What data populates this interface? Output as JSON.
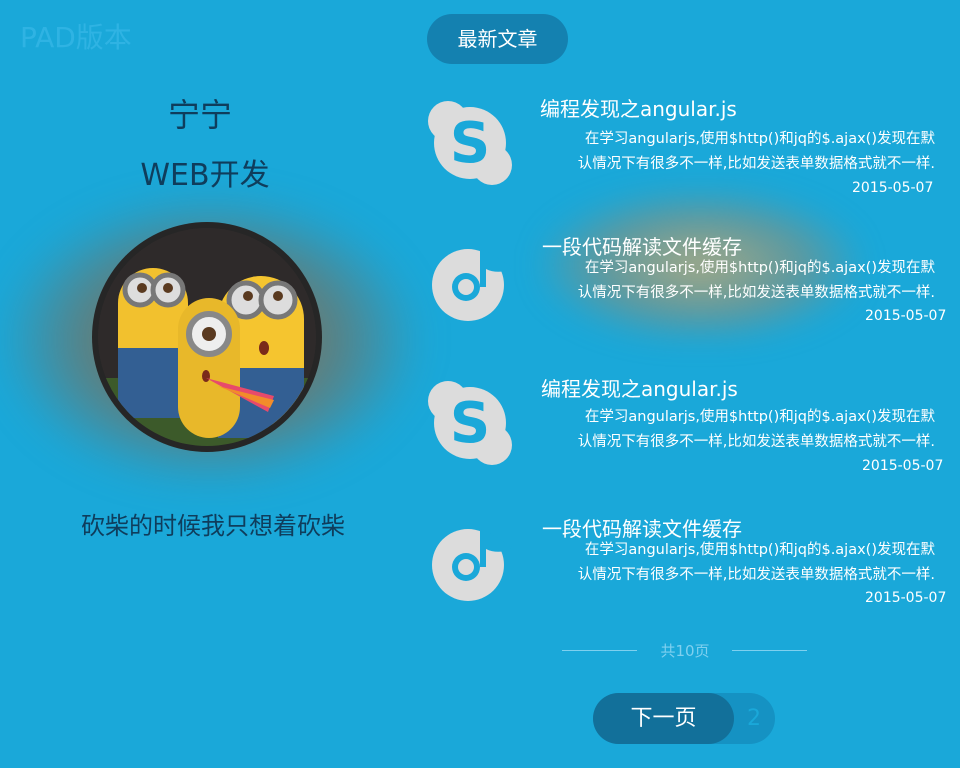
{
  "version_tag": "PAD版本",
  "profile": {
    "name": "宁宁",
    "job": "WEB开发",
    "motto": "砍柴的时候我只想着砍柴"
  },
  "section_title": "最新文章",
  "articles": [
    {
      "icon": "skype-icon",
      "title": "编程发现之angular.js",
      "desc_line1": "在学习angularjs,使用$http()和jq的$.ajax()发现在默",
      "desc_line2": "认情况下有很多不一样,比如发送表单数据格式就不一样.",
      "date": "2015-05-07"
    },
    {
      "icon": "music-note-icon",
      "title": "一段代码解读文件缓存",
      "desc_line1": "在学习angularjs,使用$http()和jq的$.ajax()发现在默",
      "desc_line2": "认情况下有很多不一样,比如发送表单数据格式就不一样.",
      "date": "2015-05-07"
    },
    {
      "icon": "skype-icon",
      "title": "编程发现之angular.js",
      "desc_line1": "在学习angularjs,使用$http()和jq的$.ajax()发现在默",
      "desc_line2": "认情况下有很多不一样,比如发送表单数据格式就不一样.",
      "date": "2015-05-07"
    },
    {
      "icon": "music-note-icon",
      "title": "一段代码解读文件缓存",
      "desc_line1": "在学习angularjs,使用$http()和jq的$.ajax()发现在默",
      "desc_line2": "认情况下有很多不一样,比如发送表单数据格式就不一样.",
      "date": "2015-05-07"
    }
  ],
  "pager": {
    "total": "共10页",
    "next_label": "下一页",
    "next_page": "2"
  },
  "colors": {
    "background": "#1aa8d9",
    "accent_dark": "#12709a",
    "text_dark": "#0f3d5c"
  }
}
